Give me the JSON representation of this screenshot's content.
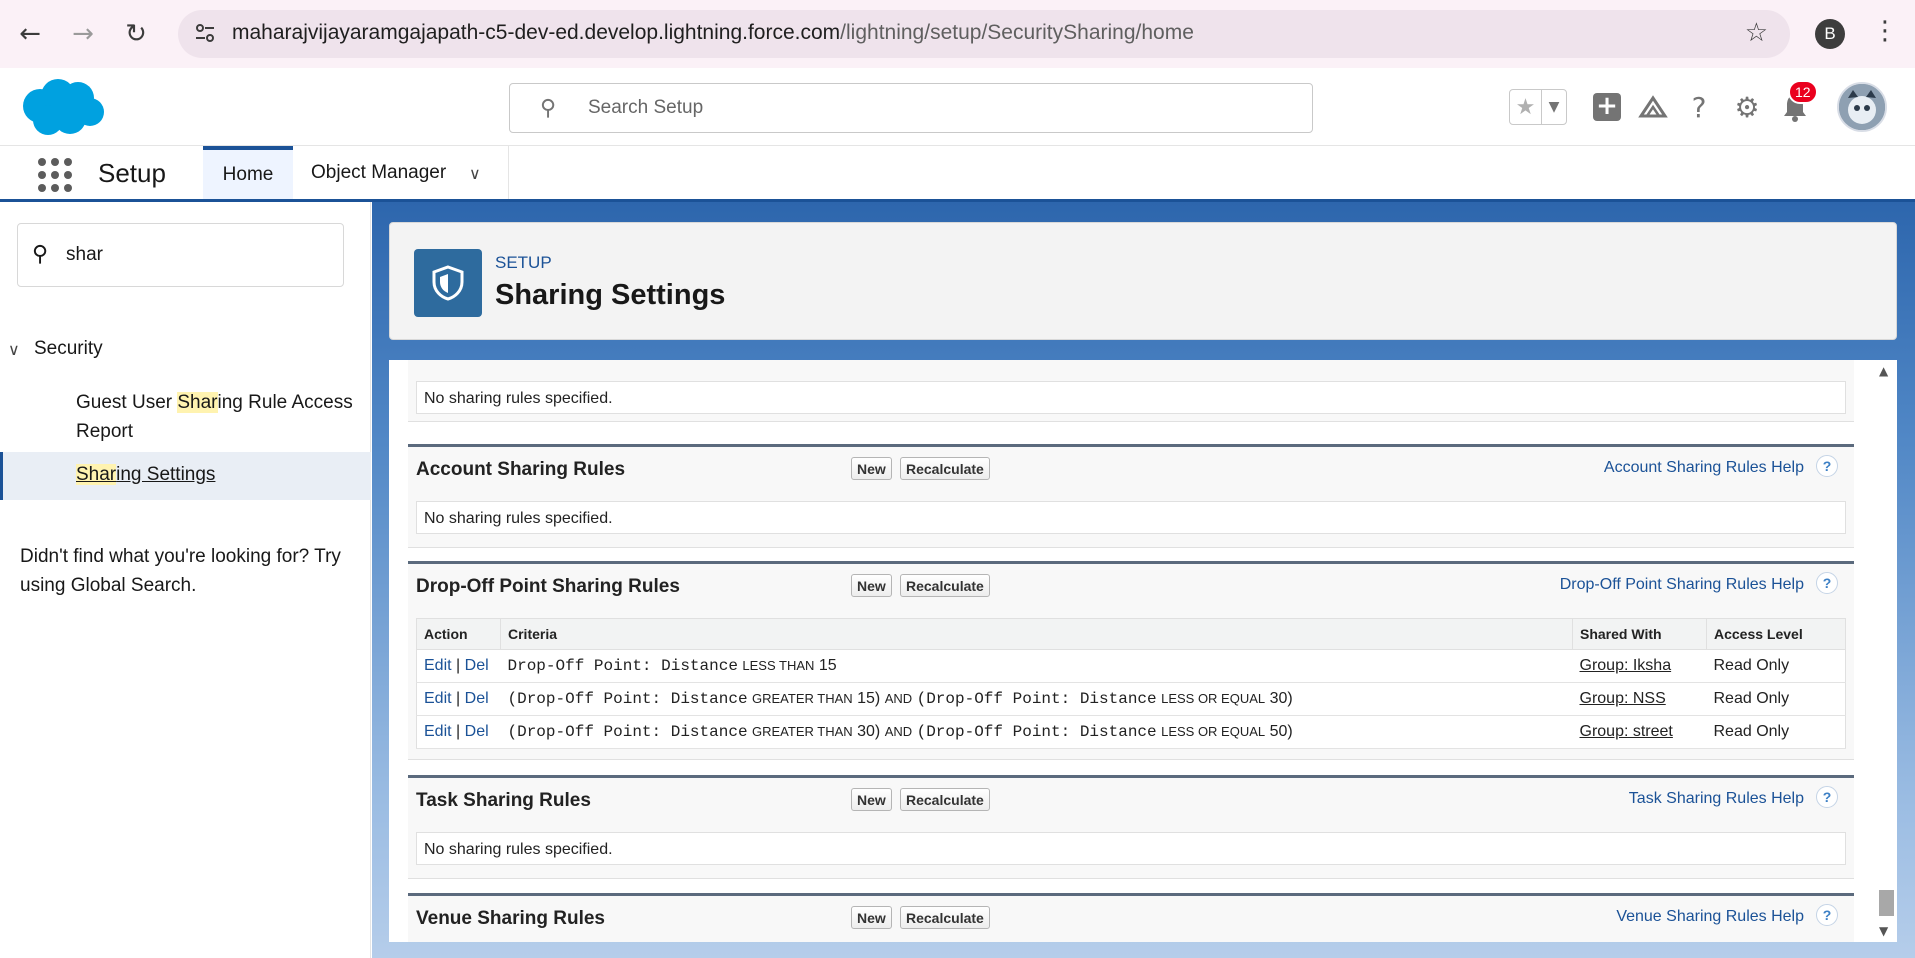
{
  "browser": {
    "url_host": "maharajvijayaramgajapath-c5-dev-ed.develop.lightning.force.com",
    "url_path": "/lightning/setup/SecuritySharing/home",
    "profile_initial": "B"
  },
  "header": {
    "search_placeholder": "Search Setup",
    "notification_count": "12"
  },
  "context": {
    "app_name": "Setup",
    "tabs": [
      {
        "label": "Home"
      },
      {
        "label": "Object Manager"
      }
    ]
  },
  "sidebar": {
    "quickfind_value": "shar",
    "section": "Security",
    "item1": {
      "pre": "Guest User ",
      "hl": "Shar",
      "post": "ing Rule Access Report"
    },
    "item2": {
      "pre": "",
      "hl": "Shar",
      "post": "ing Settings"
    },
    "not_found": "Didn't find what you're looking for? Try using Global Search."
  },
  "page": {
    "eyebrow": "SETUP",
    "title": "Sharing Settings"
  },
  "blocks": {
    "top_empty": "No sharing rules specified.",
    "new_label": "New",
    "recalc_label": "Recalculate",
    "account": {
      "title": "Account Sharing Rules",
      "help": "Account Sharing Rules Help",
      "empty": "No sharing rules specified."
    },
    "dropoff": {
      "title": "Drop-Off Point Sharing Rules",
      "help": "Drop-Off Point Sharing Rules Help",
      "columns": [
        "Action",
        "Criteria",
        "Shared With",
        "Access Level"
      ],
      "edit": "Edit",
      "sep": "|",
      "del": "Del",
      "rows": [
        {
          "c1": "Drop-Off Point: Distance",
          "op1": "LESS THAN",
          "v1": "15",
          "and": "",
          "c2": "",
          "op2": "",
          "v2": "",
          "shared": "Group: Iksha",
          "access": "Read Only"
        },
        {
          "c1": "(Drop-Off Point: Distance",
          "op1": "GREATER THAN",
          "v1": "15)",
          "and": "AND",
          "c2": "(Drop-Off Point: Distance",
          "op2": "LESS OR EQUAL",
          "v2": "30)",
          "shared": "Group: NSS",
          "access": "Read Only"
        },
        {
          "c1": "(Drop-Off Point: Distance",
          "op1": "GREATER THAN",
          "v1": "30)",
          "and": "AND",
          "c2": "(Drop-Off Point: Distance",
          "op2": "LESS OR EQUAL",
          "v2": "50)",
          "shared": "Group: street",
          "access": "Read Only"
        }
      ]
    },
    "task": {
      "title": "Task Sharing Rules",
      "help": "Task Sharing Rules Help",
      "empty": "No sharing rules specified."
    },
    "venue": {
      "title": "Venue Sharing Rules",
      "help": "Venue Sharing Rules Help"
    },
    "help_glyph": "?"
  }
}
